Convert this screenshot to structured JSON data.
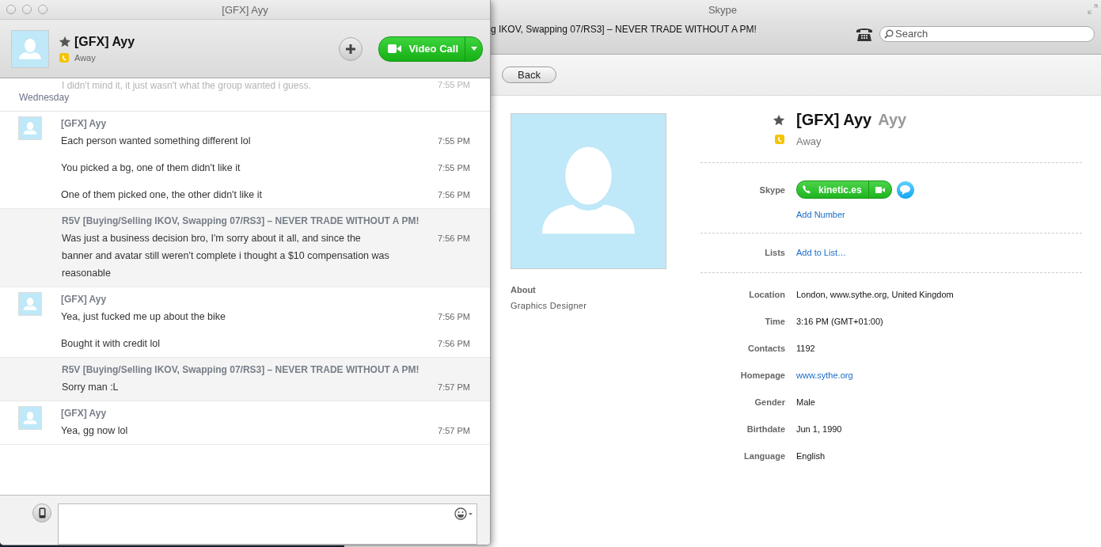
{
  "skype_window": {
    "title": "Skype",
    "conversation_title": "g IKOV, Swapping 07/RS3] – NEVER TRADE WITHOUT A PM!",
    "search": {
      "placeholder": "Search"
    },
    "back_button": "Back",
    "profile": {
      "name": "[GFX] Ayy",
      "alias": "Ayy",
      "favorite": true,
      "status": "Away",
      "about_label": "About",
      "about_text": "Graphics Designer",
      "skype_label": "Skype",
      "skype_name": "kinetic.es",
      "add_number": "Add Number",
      "lists_label": "Lists",
      "add_to_list": "Add to List…",
      "fields": [
        {
          "label": "Location",
          "value": "London, www.sythe.org, United Kingdom",
          "kind": "text"
        },
        {
          "label": "Time",
          "value": "3:16 PM (GMT+01:00)",
          "kind": "text"
        },
        {
          "label": "Contacts",
          "value": "1192",
          "kind": "text"
        },
        {
          "label": "Homepage",
          "value": "www.sythe.org",
          "kind": "link"
        },
        {
          "label": "Gender",
          "value": "Male",
          "kind": "text"
        },
        {
          "label": "Birthdate",
          "value": "Jun 1, 1990",
          "kind": "text"
        },
        {
          "label": "Language",
          "value": "English",
          "kind": "text"
        }
      ]
    }
  },
  "chat_window": {
    "title": "[GFX] Ayy",
    "contact": {
      "name": "[GFX] Ayy",
      "status": "Away",
      "favorite": true
    },
    "video_call": "Video Call",
    "faded_message": {
      "text": "I didn't mind it, it just wasn't what the group wanted i guess.",
      "time": "7:55 PM"
    },
    "date_header": "Wednesday",
    "groups": [
      {
        "kind": "contact",
        "sender": "[GFX] Ayy",
        "messages": [
          {
            "text": "Each person wanted something different lol",
            "time": "7:55 PM"
          },
          {
            "text": "You picked a bg, one of them didn't like it",
            "time": "7:55 PM"
          },
          {
            "text": "One of them picked one, the other didn't like it",
            "time": "7:56 PM"
          }
        ]
      },
      {
        "kind": "self",
        "sender": "R5V [Buying/Selling IKOV, Swapping 07/RS3] – NEVER TRADE WITHOUT A PM!",
        "messages": [
          {
            "text": "Was just a business decision bro, I'm sorry about it all, and since the banner and avatar still weren't complete i thought a $10 compensation was reasonable",
            "time": "7:56 PM"
          }
        ]
      },
      {
        "kind": "contact",
        "sender": "[GFX] Ayy",
        "messages": [
          {
            "text": "Yea, just fucked me up about the bike",
            "time": "7:56 PM"
          },
          {
            "text": "Bought it with credit lol",
            "time": "7:56 PM"
          }
        ]
      },
      {
        "kind": "self",
        "sender": "R5V [Buying/Selling IKOV, Swapping 07/RS3] – NEVER TRADE WITHOUT A PM!",
        "messages": [
          {
            "text": "Sorry man :L",
            "time": "7:57 PM"
          }
        ]
      },
      {
        "kind": "contact",
        "sender": "[GFX] Ayy",
        "messages": [
          {
            "text": "Yea, gg now lol",
            "time": "7:57 PM"
          }
        ]
      }
    ]
  }
}
